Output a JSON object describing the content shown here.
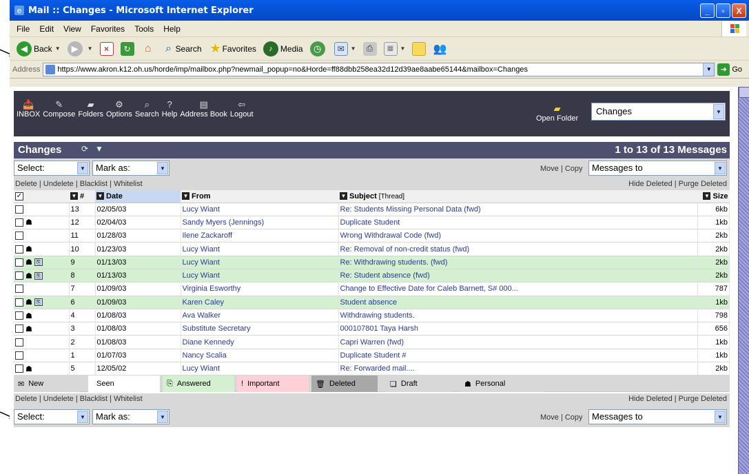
{
  "window": {
    "title": "Mail :: Changes - Microsoft Internet Explorer",
    "controls": {
      "minimize": "_",
      "maximize": "▫",
      "close": "X"
    }
  },
  "menu": [
    "File",
    "Edit",
    "View",
    "Favorites",
    "Tools",
    "Help"
  ],
  "toolbar": {
    "back": "Back",
    "search": "Search",
    "favorites": "Favorites",
    "media": "Media"
  },
  "address": {
    "label": "Address",
    "url": "https://www.akron.k12.oh.us/horde/imp/mailbox.php?newmail_popup=no&Horde=ff88dbb258ea32d12d39ae8aabe65144&mailbox=Changes",
    "go": "Go"
  },
  "mailnav": {
    "items": [
      {
        "icon": "inbox-icon",
        "glyph": "📥",
        "label": "INBOX"
      },
      {
        "icon": "compose-icon",
        "glyph": "✎",
        "label": "Compose"
      },
      {
        "icon": "folders-icon",
        "glyph": "▰",
        "label": "Folders"
      },
      {
        "icon": "options-icon",
        "glyph": "⚙",
        "label": "Options"
      },
      {
        "icon": "search-icon",
        "glyph": "⌕",
        "label": "Search"
      },
      {
        "icon": "help-icon",
        "glyph": "?",
        "label": "Help"
      },
      {
        "icon": "address-book-icon",
        "glyph": "▤",
        "label": "Address Book"
      },
      {
        "icon": "logout-icon",
        "glyph": "⇦",
        "label": "Logout"
      }
    ],
    "open_folder": "Open Folder",
    "folder_value": "Changes"
  },
  "mailbox": {
    "name": "Changes",
    "count_text": "1 to 13 of 13 Messages",
    "select_label": "Select:",
    "markas_label": "Mark as:",
    "move_copy": "Move | Copy",
    "messages_to": "Messages to",
    "left_links": "Delete | Undelete | Blacklist | Whitelist",
    "right_links": "Hide Deleted | Purge Deleted"
  },
  "columns": {
    "num": "#",
    "date": "Date",
    "from": "From",
    "subject": "Subject",
    "thread": "[Thread]",
    "size": "Size"
  },
  "messages": [
    {
      "personal": false,
      "answered": false,
      "num": "13",
      "date": "02/05/03",
      "from": "Lucy Wiant",
      "subject": "Re: Students Missing Personal Data (fwd)",
      "size": "6kb"
    },
    {
      "personal": true,
      "answered": false,
      "num": "12",
      "date": "02/04/03",
      "from": "Sandy Myers (Jennings)",
      "subject": "Duplicate Student",
      "size": "1kb"
    },
    {
      "personal": false,
      "answered": false,
      "num": "11",
      "date": "01/28/03",
      "from": "Ilene Zackaroff",
      "subject": "Wrong Withdrawal Code (fwd)",
      "size": "2kb"
    },
    {
      "personal": true,
      "answered": false,
      "num": "10",
      "date": "01/23/03",
      "from": "Lucy Wiant",
      "subject": "Re: Removal of non-credit status (fwd)",
      "size": "2kb"
    },
    {
      "personal": true,
      "answered": true,
      "num": "9",
      "date": "01/13/03",
      "from": "Lucy Wiant",
      "subject": "Re: Withdrawing students. (fwd)",
      "size": "2kb"
    },
    {
      "personal": true,
      "answered": true,
      "num": "8",
      "date": "01/13/03",
      "from": "Lucy Wiant",
      "subject": "Re: Student absence (fwd)",
      "size": "2kb"
    },
    {
      "personal": false,
      "answered": false,
      "num": "7",
      "date": "01/09/03",
      "from": "Virginia Esworthy",
      "subject": "Change to Effective Date for Caleb Barnett, S# 000...",
      "size": "787"
    },
    {
      "personal": true,
      "answered": true,
      "num": "6",
      "date": "01/09/03",
      "from": "Karen Caley",
      "subject": "Student absence",
      "size": "1kb"
    },
    {
      "personal": true,
      "answered": false,
      "num": "4",
      "date": "01/08/03",
      "from": "Ava Walker",
      "subject": "Withdrawing students.",
      "size": "798"
    },
    {
      "personal": true,
      "answered": false,
      "num": "3",
      "date": "01/08/03",
      "from": "Substitute Secretary",
      "subject": "000107801 Taya Harsh",
      "size": "656"
    },
    {
      "personal": false,
      "answered": false,
      "num": "2",
      "date": "01/08/03",
      "from": "Diane Kennedy",
      "subject": "Capri Warren (fwd)",
      "size": "1kb"
    },
    {
      "personal": false,
      "answered": false,
      "num": "1",
      "date": "01/07/03",
      "from": "Nancy Scalia",
      "subject": "Duplicate Student #",
      "size": "1kb"
    },
    {
      "personal": true,
      "answered": false,
      "num": "5",
      "date": "12/05/02",
      "from": "Lucy Wiant",
      "subject": "Re: Forwarded mail....",
      "size": "2kb"
    }
  ],
  "legend": [
    {
      "icon": "new-envelope-icon",
      "glyph": "✉",
      "label": "New",
      "bg": "#d8d8d8"
    },
    {
      "icon": "seen-icon",
      "glyph": "",
      "label": "Seen",
      "bg": "#ffffff"
    },
    {
      "icon": "answered-icon",
      "glyph": "⎘",
      "label": "Answered",
      "bg": "#d4f0d0"
    },
    {
      "icon": "important-icon",
      "glyph": "!",
      "label": "Important",
      "bg": "#ffd0d8"
    },
    {
      "icon": "deleted-icon",
      "glyph": "🗑",
      "label": "Deleted",
      "bg": "#a8a8a8"
    },
    {
      "icon": "draft-icon",
      "glyph": "❏",
      "label": "Draft",
      "bg": "#d8d8d8"
    },
    {
      "icon": "personal-icon",
      "glyph": "☗",
      "label": "Personal",
      "bg": "#d8d8d8"
    }
  ],
  "colors": {
    "answered_row": "#d4f0d0",
    "link": "#2a3a9a",
    "nav_bg": "#383848",
    "panel_head": "#4e5070"
  }
}
